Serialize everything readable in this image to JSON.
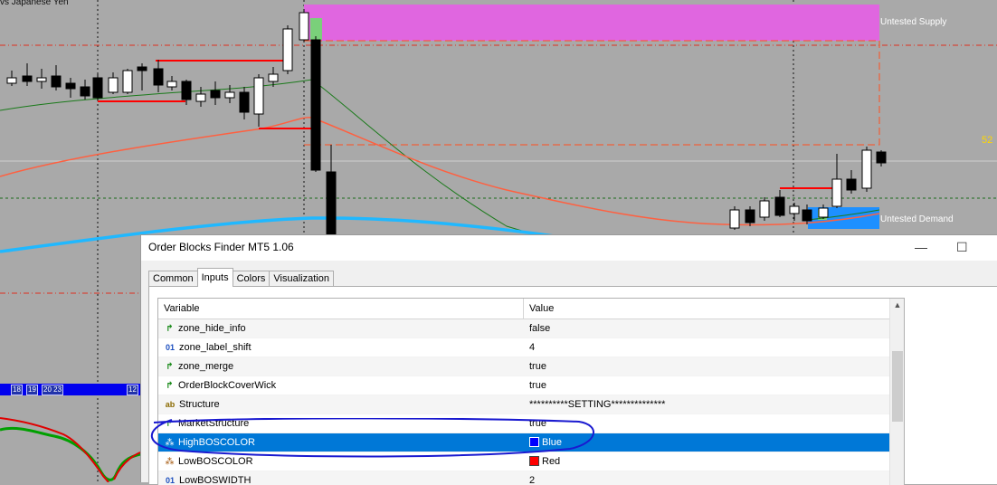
{
  "chart": {
    "symbol_title": "vs Japanese Yen",
    "zone_supply_label": "Untested Supply",
    "zone_demand_label": "Untested Demand",
    "price_tag": "52",
    "strip_tags": [
      "18",
      "19",
      "20 23",
      "12"
    ],
    "colors": {
      "background": "#a9a9a9",
      "supply_zone": "#e066e0",
      "demand_zone": "#1e90ff",
      "bos_line": "#ff0000",
      "ma_slow": "#ff6040",
      "ma_fast": "#1a7a1a",
      "ma_blue": "#20b8ff",
      "zone_outline": "#ff5020"
    }
  },
  "dialog": {
    "title": "Order Blocks Finder MT5 1.06",
    "tabs": [
      "Common",
      "Inputs",
      "Colors",
      "Visualization"
    ],
    "active_tab": "Inputs",
    "columns": {
      "variable": "Variable",
      "value": "Value"
    },
    "rows": [
      {
        "icon": "bool",
        "name": "zone_hide_info",
        "value": "false"
      },
      {
        "icon": "int",
        "name": "zone_label_shift",
        "value": "4"
      },
      {
        "icon": "bool",
        "name": "zone_merge",
        "value": "true"
      },
      {
        "icon": "bool",
        "name": "OrderBlockCoverWick",
        "value": "true"
      },
      {
        "icon": "str",
        "name": "Structure",
        "value": "**********SETTING**************"
      },
      {
        "icon": "bool",
        "name": "MarketStructure",
        "value": "true"
      },
      {
        "icon": "color",
        "name": "HighBOSCOLOR",
        "value": "Blue",
        "swatch": "#0000ff",
        "selected": true
      },
      {
        "icon": "color",
        "name": "LowBOSCOLOR",
        "value": "Red",
        "swatch": "#ff0000"
      },
      {
        "icon": "int",
        "name": "LowBOSWIDTH",
        "value": "2"
      }
    ],
    "icon_glyphs": {
      "bool": "↱",
      "int": "01",
      "str": "ab",
      "color": "⁂"
    },
    "titlebar_buttons": {
      "minimize": "—",
      "maximize": "☐"
    }
  }
}
